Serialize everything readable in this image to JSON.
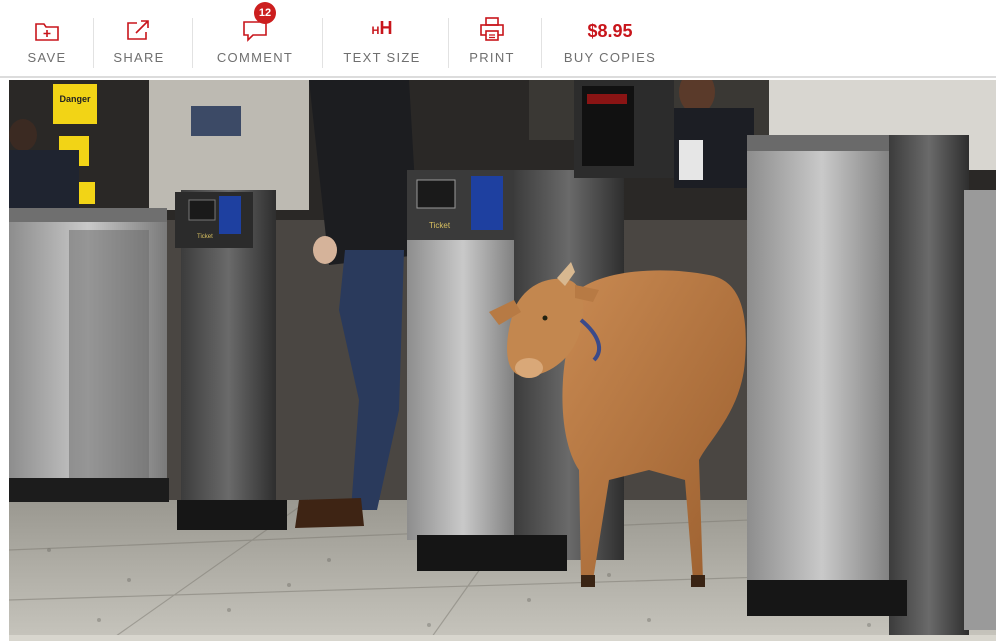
{
  "toolbar": {
    "save_label": "SAVE",
    "share_label": "SHARE",
    "comment_label": "COMMENT",
    "comment_count": "12",
    "text_size_label": "TEXT SIZE",
    "text_size_icon_small": "H",
    "text_size_icon_large": "H",
    "print_label": "PRINT",
    "price": "$8.95",
    "buy_label": "BUY COPIES",
    "accent_color": "#c8151b",
    "icons": [
      "save-icon",
      "share-icon",
      "comment-icon",
      "text-size-icon",
      "print-icon"
    ]
  },
  "photo": {
    "description_icon": "photo",
    "signage": {
      "danger_sign": "Danger",
      "gate_label_left": "Ticket",
      "gate_label_center": "Ticket"
    }
  }
}
